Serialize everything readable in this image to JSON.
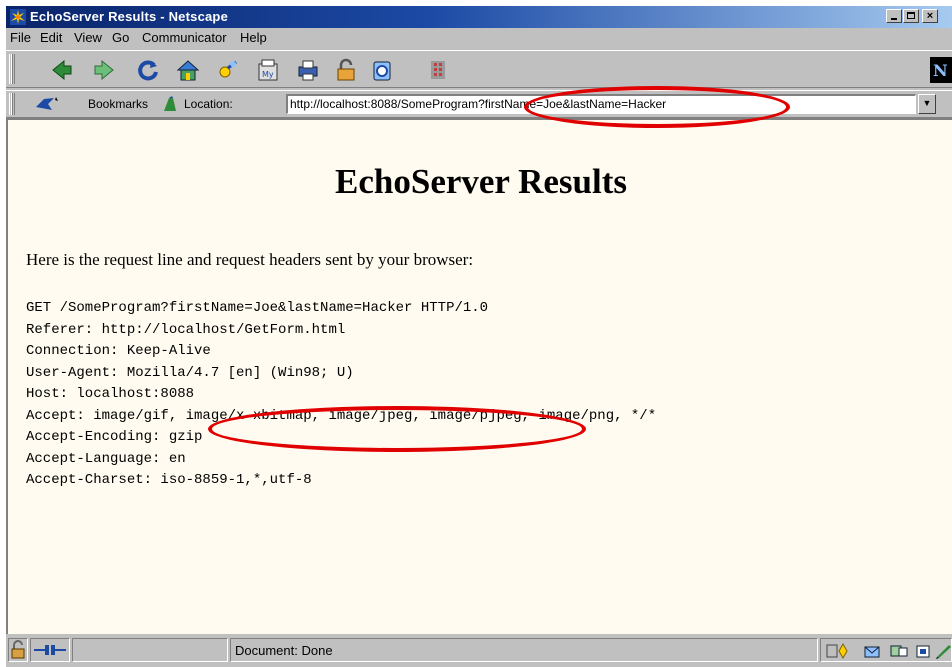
{
  "window": {
    "title": "EchoServer Results - Netscape"
  },
  "menu": [
    {
      "label": "File"
    },
    {
      "label": "Edit"
    },
    {
      "label": "View"
    },
    {
      "label": "Go"
    },
    {
      "label": "Communicator"
    },
    {
      "label": "Help"
    }
  ],
  "toolbar": {
    "buttons": [
      "back-icon",
      "forward-icon",
      "reload-icon",
      "home-icon",
      "search-icon",
      "my-netscape-icon",
      "print-icon",
      "security-icon",
      "shop-icon",
      "stop-icon"
    ]
  },
  "location": {
    "bookmarks_label": "Bookmarks",
    "location_label": "Location:",
    "url": "http://localhost:8088/SomeProgram?firstName=Joe&lastName=Hacker"
  },
  "page": {
    "heading": "EchoServer Results",
    "intro": "Here is the request line and request headers sent by your browser:",
    "lines": [
      "GET /SomeProgram?firstName=Joe&lastName=Hacker HTTP/1.0",
      "Referer: http://localhost/GetForm.html",
      "Connection: Keep-Alive",
      "User-Agent: Mozilla/4.7 [en] (Win98; U)",
      "Host: localhost:8088",
      "Accept: image/gif, image/x-xbitmap, image/jpeg, image/pjpeg, image/png, */*",
      "Accept-Encoding: gzip",
      "Accept-Language: en",
      "Accept-Charset: iso-8859-1,*,utf-8"
    ]
  },
  "status": {
    "text": "Document: Done"
  },
  "colors": {
    "highlight": "#e00000",
    "page_background": "#fffbf0",
    "titlebar": "#0a246a"
  }
}
